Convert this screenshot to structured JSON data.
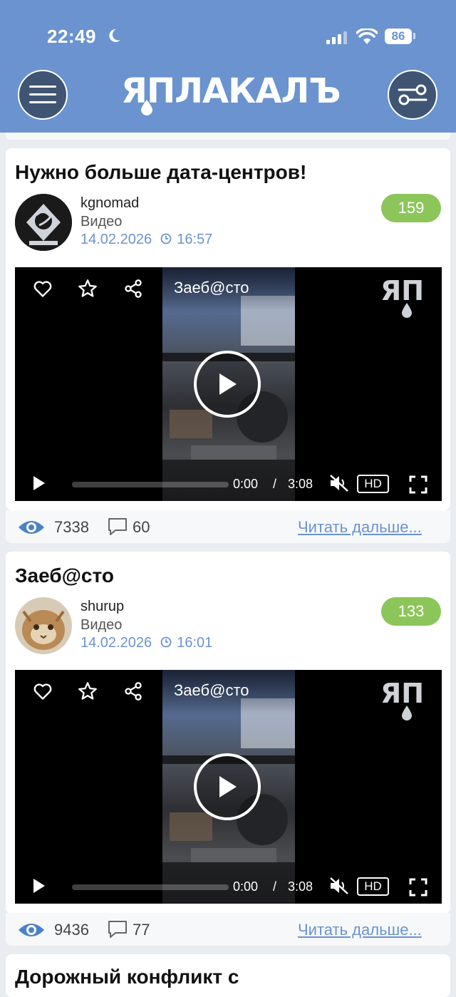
{
  "status_bar": {
    "time": "22:49",
    "battery": "86"
  },
  "header": {
    "logo_text": "ЯПЛАКАЛЪ",
    "menu_icon": "hamburger-menu-icon",
    "filter_icon": "sliders-icon",
    "brand_color": "#6a93cf"
  },
  "posts": [
    {
      "title": "Нужно больше дата-центров!",
      "author": "kgnomad",
      "category": "Видео",
      "date": "14.02.2026",
      "time": "16:57",
      "rating": "159",
      "video": {
        "title": "Заеб@сто",
        "current_time": "0:00",
        "separator": "/",
        "duration": "3:08",
        "hd_label": "HD",
        "watermark": "ЯП"
      },
      "views": "7338",
      "comments": "60",
      "read_more": "Читать дальше..."
    },
    {
      "title": "Заеб@сто",
      "author": "shurup",
      "category": "Видео",
      "date": "14.02.2026",
      "time": "16:01",
      "rating": "133",
      "video": {
        "title": "Заеб@сто",
        "current_time": "0:00",
        "separator": "/",
        "duration": "3:08",
        "hd_label": "HD",
        "watermark": "ЯП"
      },
      "views": "9436",
      "comments": "77",
      "read_more": "Читать дальше..."
    },
    {
      "title": "Дорожный конфликт с"
    }
  ],
  "colors": {
    "rating_badge": "#8cc65a",
    "link": "#6a93cf",
    "header": "#6a93cf"
  }
}
